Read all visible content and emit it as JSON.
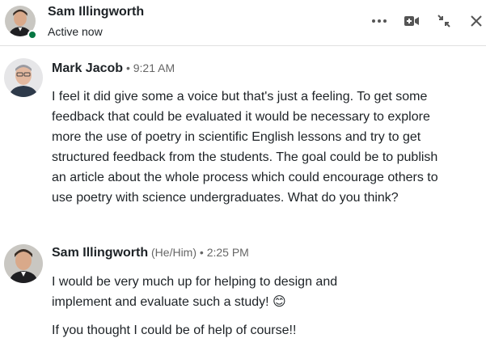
{
  "header": {
    "contact_name": "Sam Illingworth",
    "status": "Active now",
    "icons": [
      "more-options-icon",
      "video-call-icon",
      "minimize-icon",
      "close-icon"
    ],
    "presence_color": "#057642"
  },
  "messages": [
    {
      "author": "Mark Jacob",
      "separator": "•",
      "time": "9:21 AM",
      "paragraphs": [
        "I feel it did give some a voice but that's just a feeling. To get some feedback that could be evaluated it would be necessary to explore more the use of poetry in scientific English lessons and try to get structured feedback from the students. The goal could be to publish an article about the whole process which could encourage others to use poetry with science undergraduates. What do you think?"
      ]
    },
    {
      "author": "Sam Illingworth",
      "pronouns": "(He/Him)",
      "separator": "•",
      "time": "2:25 PM",
      "paragraphs": [
        "I would be very much up for helping to design and implement and evaluate such a study! 😊",
        "If you thought I could be of help of course!!"
      ]
    }
  ]
}
